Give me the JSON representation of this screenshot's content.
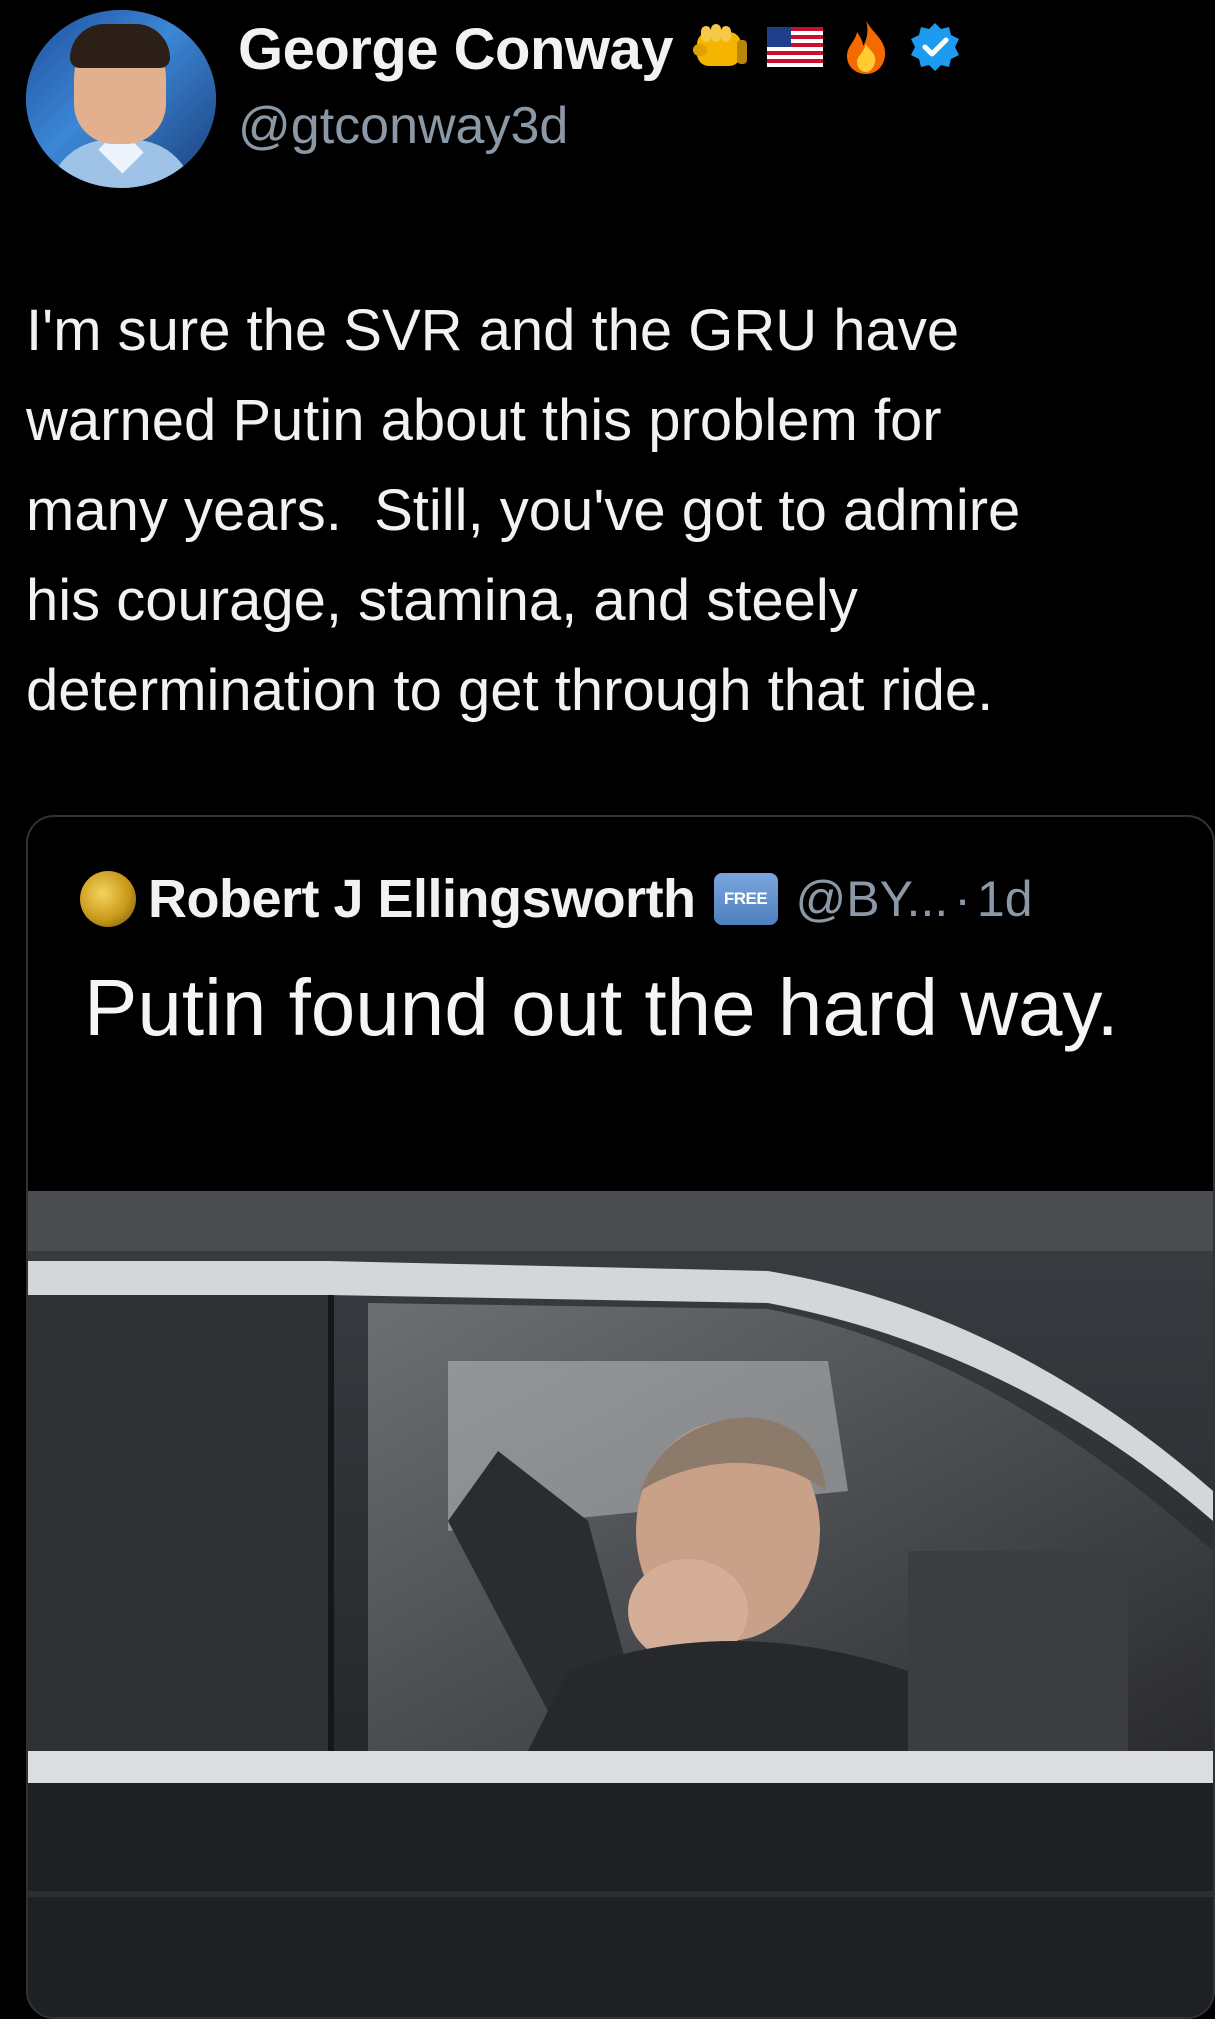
{
  "author": {
    "name": "George Conway",
    "handle": "@gtconway3d",
    "badges": [
      "fist-emoji",
      "us-flag-emoji",
      "fire-emoji",
      "verified-badge"
    ]
  },
  "tweet": {
    "text": "I'm sure the SVR and the GRU have\nwarned Putin about this problem for\nmany years.  Still, you've got to admire\nhis courage, stamina, and steely\ndetermination to get through that ride."
  },
  "quoted": {
    "name": "Robert J Ellingsworth",
    "badge": "FREE",
    "handle": "@BY...",
    "separator": "·",
    "time": "1d",
    "text": "Putin found out the hard way.",
    "image": "man-in-car-window-photo"
  },
  "colors": {
    "background": "#000000",
    "text": "#e7e9ea",
    "secondary": "#8b98a5",
    "verified": "#1d9bf0",
    "border": "#2f3336"
  }
}
